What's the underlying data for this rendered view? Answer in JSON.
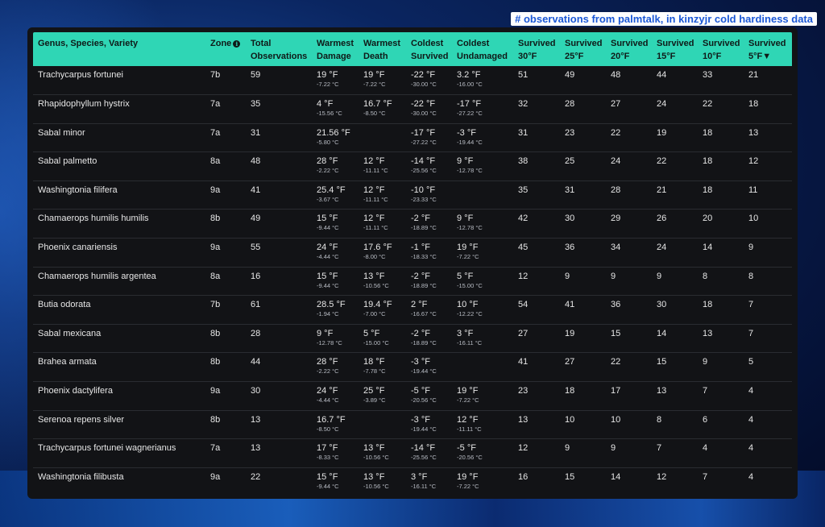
{
  "caption": "# observations from palmtalk, in kinzyjr cold hardiness data",
  "columns": [
    {
      "line1": "Genus, Species, Variety",
      "line2": ""
    },
    {
      "line1": "Zone",
      "line2": "",
      "icon": "info-icon"
    },
    {
      "line1": "Total",
      "line2": "Observations"
    },
    {
      "line1": "Warmest",
      "line2": "Damage"
    },
    {
      "line1": "Warmest",
      "line2": "Death"
    },
    {
      "line1": "Coldest",
      "line2": "Survived"
    },
    {
      "line1": "Coldest",
      "line2": "Undamaged"
    },
    {
      "line1": "Survived",
      "line2": "30°F"
    },
    {
      "line1": "Survived",
      "line2": "25°F"
    },
    {
      "line1": "Survived",
      "line2": "20°F"
    },
    {
      "line1": "Survived",
      "line2": "15°F"
    },
    {
      "line1": "Survived",
      "line2": "10°F"
    },
    {
      "line1": "Survived",
      "line2": "5°F▼"
    }
  ],
  "rows": [
    {
      "name": "Trachycarpus fortunei",
      "zone": "7b",
      "total": "59",
      "warmest_damage": {
        "f": "19 °F",
        "c": "-7.22 °C"
      },
      "warmest_death": {
        "f": "19 °F",
        "c": "-7.22 °C"
      },
      "coldest_survived": {
        "f": "-22 °F",
        "c": "-30.00 °C"
      },
      "coldest_undamaged": {
        "f": "3.2 °F",
        "c": "-16.00 °C"
      },
      "s30": "51",
      "s25": "49",
      "s20": "48",
      "s15": "44",
      "s10": "33",
      "s5": "21"
    },
    {
      "name": "Rhapidophyllum hystrix",
      "zone": "7a",
      "total": "35",
      "warmest_damage": {
        "f": "4 °F",
        "c": "-15.56 °C"
      },
      "warmest_death": {
        "f": "16.7 °F",
        "c": "-8.50 °C"
      },
      "coldest_survived": {
        "f": "-22 °F",
        "c": "-30.00 °C"
      },
      "coldest_undamaged": {
        "f": "-17 °F",
        "c": "-27.22 °C"
      },
      "s30": "32",
      "s25": "28",
      "s20": "27",
      "s15": "24",
      "s10": "22",
      "s5": "18"
    },
    {
      "name": "Sabal minor",
      "zone": "7a",
      "total": "31",
      "warmest_damage": {
        "f": "21.56 °F",
        "c": "-5.80 °C"
      },
      "warmest_death": {
        "f": "",
        "c": ""
      },
      "coldest_survived": {
        "f": "-17 °F",
        "c": "-27.22 °C"
      },
      "coldest_undamaged": {
        "f": "-3 °F",
        "c": "-19.44 °C"
      },
      "s30": "31",
      "s25": "23",
      "s20": "22",
      "s15": "19",
      "s10": "18",
      "s5": "13"
    },
    {
      "name": "Sabal palmetto",
      "zone": "8a",
      "total": "48",
      "warmest_damage": {
        "f": "28 °F",
        "c": "-2.22 °C"
      },
      "warmest_death": {
        "f": "12 °F",
        "c": "-11.11 °C"
      },
      "coldest_survived": {
        "f": "-14 °F",
        "c": "-25.56 °C"
      },
      "coldest_undamaged": {
        "f": "9 °F",
        "c": "-12.78 °C"
      },
      "s30": "38",
      "s25": "25",
      "s20": "24",
      "s15": "22",
      "s10": "18",
      "s5": "12"
    },
    {
      "name": "Washingtonia filifera",
      "zone": "9a",
      "total": "41",
      "warmest_damage": {
        "f": "25.4 °F",
        "c": "-3.67 °C"
      },
      "warmest_death": {
        "f": "12 °F",
        "c": "-11.11 °C"
      },
      "coldest_survived": {
        "f": "-10 °F",
        "c": "-23.33 °C"
      },
      "coldest_undamaged": {
        "f": "",
        "c": ""
      },
      "s30": "35",
      "s25": "31",
      "s20": "28",
      "s15": "21",
      "s10": "18",
      "s5": "11"
    },
    {
      "name": "Chamaerops humilis humilis",
      "zone": "8b",
      "total": "49",
      "warmest_damage": {
        "f": "15 °F",
        "c": "-9.44 °C"
      },
      "warmest_death": {
        "f": "12 °F",
        "c": "-11.11 °C"
      },
      "coldest_survived": {
        "f": "-2 °F",
        "c": "-18.89 °C"
      },
      "coldest_undamaged": {
        "f": "9 °F",
        "c": "-12.78 °C"
      },
      "s30": "42",
      "s25": "30",
      "s20": "29",
      "s15": "26",
      "s10": "20",
      "s5": "10"
    },
    {
      "name": "Phoenix canariensis",
      "zone": "9a",
      "total": "55",
      "warmest_damage": {
        "f": "24 °F",
        "c": "-4.44 °C"
      },
      "warmest_death": {
        "f": "17.6 °F",
        "c": "-8.00 °C"
      },
      "coldest_survived": {
        "f": "-1 °F",
        "c": "-18.33 °C"
      },
      "coldest_undamaged": {
        "f": "19 °F",
        "c": "-7.22 °C"
      },
      "s30": "45",
      "s25": "36",
      "s20": "34",
      "s15": "24",
      "s10": "14",
      "s5": "9"
    },
    {
      "name": "Chamaerops humilis argentea",
      "zone": "8a",
      "total": "16",
      "warmest_damage": {
        "f": "15 °F",
        "c": "-9.44 °C"
      },
      "warmest_death": {
        "f": "13 °F",
        "c": "-10.56 °C"
      },
      "coldest_survived": {
        "f": "-2 °F",
        "c": "-18.89 °C"
      },
      "coldest_undamaged": {
        "f": "5 °F",
        "c": "-15.00 °C"
      },
      "s30": "12",
      "s25": "9",
      "s20": "9",
      "s15": "9",
      "s10": "8",
      "s5": "8"
    },
    {
      "name": "Butia odorata",
      "zone": "7b",
      "total": "61",
      "warmest_damage": {
        "f": "28.5 °F",
        "c": "-1.94 °C"
      },
      "warmest_death": {
        "f": "19.4 °F",
        "c": "-7.00 °C"
      },
      "coldest_survived": {
        "f": "2 °F",
        "c": "-16.67 °C"
      },
      "coldest_undamaged": {
        "f": "10 °F",
        "c": "-12.22 °C"
      },
      "s30": "54",
      "s25": "41",
      "s20": "36",
      "s15": "30",
      "s10": "18",
      "s5": "7"
    },
    {
      "name": "Sabal mexicana",
      "zone": "8b",
      "total": "28",
      "warmest_damage": {
        "f": "9 °F",
        "c": "-12.78 °C"
      },
      "warmest_death": {
        "f": "5 °F",
        "c": "-15.00 °C"
      },
      "coldest_survived": {
        "f": "-2 °F",
        "c": "-18.89 °C"
      },
      "coldest_undamaged": {
        "f": "3 °F",
        "c": "-16.11 °C"
      },
      "s30": "27",
      "s25": "19",
      "s20": "15",
      "s15": "14",
      "s10": "13",
      "s5": "7"
    },
    {
      "name": "Brahea armata",
      "zone": "8b",
      "total": "44",
      "warmest_damage": {
        "f": "28 °F",
        "c": "-2.22 °C"
      },
      "warmest_death": {
        "f": "18 °F",
        "c": "-7.78 °C"
      },
      "coldest_survived": {
        "f": "-3 °F",
        "c": "-19.44 °C"
      },
      "coldest_undamaged": {
        "f": "",
        "c": ""
      },
      "s30": "41",
      "s25": "27",
      "s20": "22",
      "s15": "15",
      "s10": "9",
      "s5": "5"
    },
    {
      "name": "Phoenix dactylifera",
      "zone": "9a",
      "total": "30",
      "warmest_damage": {
        "f": "24 °F",
        "c": "-4.44 °C"
      },
      "warmest_death": {
        "f": "25 °F",
        "c": "-3.89 °C"
      },
      "coldest_survived": {
        "f": "-5 °F",
        "c": "-20.56 °C"
      },
      "coldest_undamaged": {
        "f": "19 °F",
        "c": "-7.22 °C"
      },
      "s30": "23",
      "s25": "18",
      "s20": "17",
      "s15": "13",
      "s10": "7",
      "s5": "4"
    },
    {
      "name": "Serenoa repens silver",
      "zone": "8b",
      "total": "13",
      "warmest_damage": {
        "f": "16.7 °F",
        "c": "-8.50 °C"
      },
      "warmest_death": {
        "f": "",
        "c": ""
      },
      "coldest_survived": {
        "f": "-3 °F",
        "c": "-19.44 °C"
      },
      "coldest_undamaged": {
        "f": "12 °F",
        "c": "-11.11 °C"
      },
      "s30": "13",
      "s25": "10",
      "s20": "10",
      "s15": "8",
      "s10": "6",
      "s5": "4"
    },
    {
      "name": "Trachycarpus fortunei wagnerianus",
      "zone": "7a",
      "total": "13",
      "warmest_damage": {
        "f": "17 °F",
        "c": "-8.33 °C"
      },
      "warmest_death": {
        "f": "13 °F",
        "c": "-10.56 °C"
      },
      "coldest_survived": {
        "f": "-14 °F",
        "c": "-25.56 °C"
      },
      "coldest_undamaged": {
        "f": "-5 °F",
        "c": "-20.56 °C"
      },
      "s30": "12",
      "s25": "9",
      "s20": "9",
      "s15": "7",
      "s10": "4",
      "s5": "4"
    },
    {
      "name": "Washingtonia filibusta",
      "zone": "9a",
      "total": "22",
      "warmest_damage": {
        "f": "15 °F",
        "c": "-9.44 °C"
      },
      "warmest_death": {
        "f": "13 °F",
        "c": "-10.56 °C"
      },
      "coldest_survived": {
        "f": "3 °F",
        "c": "-16.11 °C"
      },
      "coldest_undamaged": {
        "f": "19 °F",
        "c": "-7.22 °C"
      },
      "s30": "16",
      "s25": "15",
      "s20": "14",
      "s15": "12",
      "s10": "7",
      "s5": "4"
    }
  ]
}
